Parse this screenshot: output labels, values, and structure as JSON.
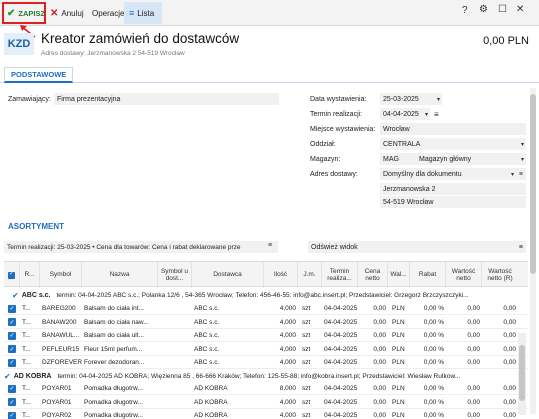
{
  "toolbar": {
    "save_label": "ZAPISZ",
    "cancel_label": "Anuluj",
    "operations_label": "Operacje",
    "list_label": "Lista",
    "help_label": "?"
  },
  "header": {
    "badge": "KZD",
    "title": "Kreator zamówień do dostawców",
    "subtitle": "Adres dostawy:  Jerzmanowska 2 54-519 Wrocław",
    "amount": "0,00 PLN"
  },
  "tabs": [
    {
      "label": "PODSTAWOWE"
    }
  ],
  "form": {
    "orderer_label": "Zamawiający:",
    "orderer_value": "Firma prezentacyjna",
    "issue_date_label": "Data wystawienia:",
    "issue_date_value": "25-03-2025",
    "delivery_date_label": "Termin realizacji:",
    "delivery_date_value": "04-04-2025",
    "place_label": "Miejsce wystawienia:",
    "place_value": "Wrocław",
    "branch_label": "Oddział:",
    "branch_value": "CENTRALA",
    "warehouse_label": "Magazyn:",
    "warehouse_code": "MAG",
    "warehouse_name": "Magazyn główny",
    "delivery_address_label": "Adres dostawy:",
    "delivery_address_value": "Domyślny dla dokumentu",
    "address_line1": "Jerzmanowska 2",
    "address_line2": "54-519 Wrocław"
  },
  "assortment": {
    "section_title": "ASORTYMENT",
    "term_bar": "Termin realizacji: 25-03-2025  •  Cena dla towarów: Cena i rabat deklarowane prze",
    "refresh_label": "Odśwież widok",
    "columns": [
      "R...",
      "Symbol",
      "Nazwa",
      "Symbol u dost...",
      "Dostawca",
      "Ilość",
      "J.m.",
      "Termin realiza...",
      "Cena netto",
      "Wal...",
      "Rabat",
      "Wartość netto",
      "Wartość netto (R)"
    ],
    "groups": [
      {
        "name": "ABC s.c.",
        "info": "termin: 04-04-2025   ABC s.c.; Polanka  12/6 , 54-365 Wrocław; Telefon: 456-46-55; info@abc.insert.pl; Przedstawiciel: Grzegorz Brzczyszczyki...",
        "rows": [
          {
            "r": "T...",
            "symbol": "BAREG200",
            "name": "Balsam do ciała int...",
            "supplier_symbol": "",
            "supplier": "ABC s.c.",
            "qty": "4,000",
            "unit": "szt",
            "term": "04-04-2025",
            "price": "0,00",
            "currency": "PLN",
            "discount": "0,00 %",
            "net": "0,00",
            "net_r": "0,00"
          },
          {
            "r": "T...",
            "symbol": "BANAW200",
            "name": "Balsam do ciała naw...",
            "supplier_symbol": "",
            "supplier": "ABC s.c.",
            "qty": "4,000",
            "unit": "szt",
            "term": "04-04-2025",
            "price": "0,00",
            "currency": "PLN",
            "discount": "0,00 %",
            "net": "0,00",
            "net_r": "0,00"
          },
          {
            "r": "T...",
            "symbol": "BANAWUL...",
            "name": "Balsam do ciała ult...",
            "supplier_symbol": "",
            "supplier": "ABC s.c.",
            "qty": "4,000",
            "unit": "szt",
            "term": "04-04-2025",
            "price": "0,00",
            "currency": "PLN",
            "discount": "0,00 %",
            "net": "0,00",
            "net_r": "0,00"
          },
          {
            "r": "T...",
            "symbol": "PEFLEUR15",
            "name": "Fleur 15ml perfum...",
            "supplier_symbol": "",
            "supplier": "ABC s.c.",
            "qty": "4,000",
            "unit": "szt",
            "term": "04-04-2025",
            "price": "0,00",
            "currency": "PLN",
            "discount": "0,00 %",
            "net": "0,00",
            "net_r": "0,00"
          },
          {
            "r": "T...",
            "symbol": "DZFOREVER",
            "name": "Forever dezodoran...",
            "supplier_symbol": "",
            "supplier": "ABC s.c.",
            "qty": "4,000",
            "unit": "szt",
            "term": "04-04-2025",
            "price": "0,00",
            "currency": "PLN",
            "discount": "0,00 %",
            "net": "0,00",
            "net_r": "0,00"
          }
        ]
      },
      {
        "name": "AD KOBRA",
        "info": "termin: 04-04-2025   AD KOBRA; Więzienna  85 , 66-666 Kraków; Telefon: 125-55-88; info@kobra.insert.pl; Przedstawiciel: Wiesław Rutkow...",
        "rows": [
          {
            "r": "T...",
            "symbol": "POYAR01",
            "name": "Pomadka długotrw...",
            "supplier_symbol": "",
            "supplier": "AD KOBRA",
            "qty": "8,000",
            "unit": "szt",
            "term": "04-04-2025",
            "price": "0,00",
            "currency": "PLN",
            "discount": "0,00 %",
            "net": "0,00",
            "net_r": "0,00"
          },
          {
            "r": "T...",
            "symbol": "POYAR01",
            "name": "Pomadka długotrw...",
            "supplier_symbol": "",
            "supplier": "AD KOBRA",
            "qty": "4,000",
            "unit": "szt",
            "term": "04-04-2025",
            "price": "0,00",
            "currency": "PLN",
            "discount": "0,00 %",
            "net": "0,00",
            "net_r": "0,00"
          },
          {
            "r": "T...",
            "symbol": "POYAR02",
            "name": "Pomadka długotrw...",
            "supplier_symbol": "",
            "supplier": "AD KOBRA",
            "qty": "4,000",
            "unit": "szt",
            "term": "04-04-2025",
            "price": "0,00",
            "currency": "PLN",
            "discount": "0,00 %",
            "net": "0,00",
            "net_r": "0,00"
          }
        ]
      }
    ]
  },
  "colors": {
    "accent": "#1f6fbf",
    "save_green": "#2a7a2a",
    "highlight_red": "#e02020",
    "field_bg": "#f1f1f1"
  }
}
